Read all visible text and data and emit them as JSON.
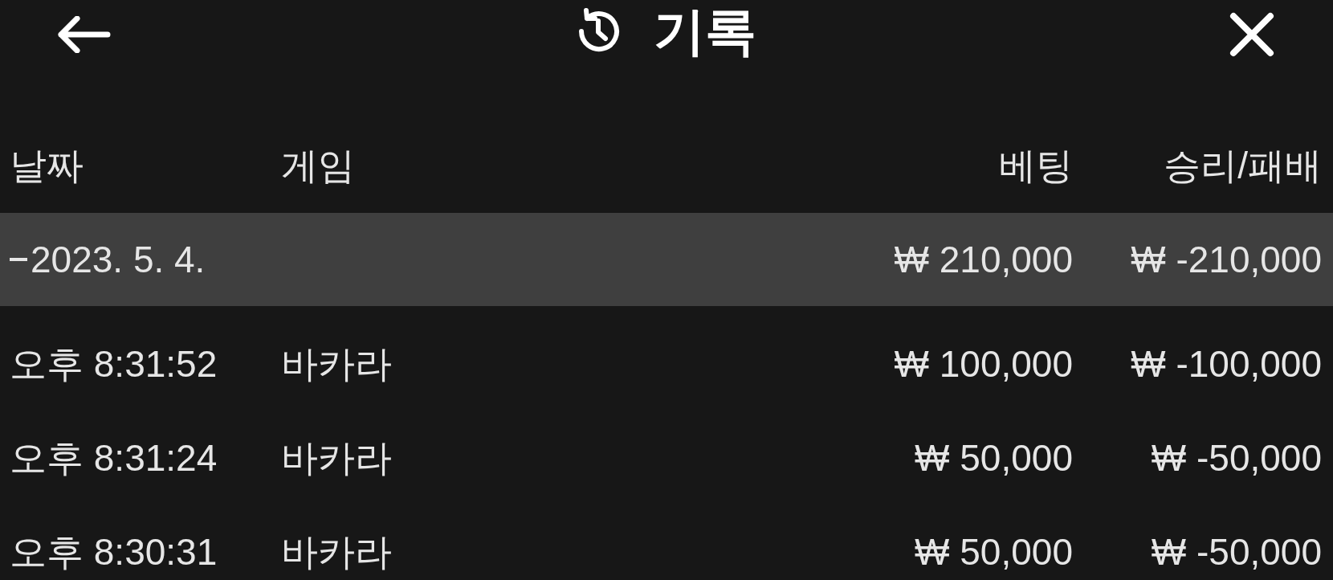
{
  "header": {
    "title": "기록"
  },
  "table": {
    "columns": [
      "날짜",
      "게임",
      "베팅",
      "승리/패배"
    ],
    "groups": [
      {
        "date": "2023. 5. 4.",
        "expanded": true,
        "bet": "₩ 210,000",
        "result": "₩ -210,000",
        "rows": [
          {
            "time": "오후 8:31:52",
            "game": "바카라",
            "bet": "₩ 100,000",
            "result": "₩ -100,000"
          },
          {
            "time": "오후 8:31:24",
            "game": "바카라",
            "bet": "₩ 50,000",
            "result": "₩ -50,000"
          },
          {
            "time": "오후 8:30:31",
            "game": "바카라",
            "bet": "₩ 50,000",
            "result": "₩ -50,000"
          }
        ]
      }
    ]
  }
}
